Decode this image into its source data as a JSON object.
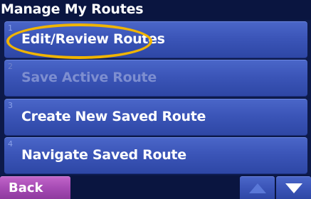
{
  "title": "Manage My Routes",
  "menu": [
    {
      "number": "1",
      "label": "Edit/Review Routes",
      "enabled": true
    },
    {
      "number": "2",
      "label": "Save Active Route",
      "enabled": false
    },
    {
      "number": "3",
      "label": "Create New Saved Route",
      "enabled": true
    },
    {
      "number": "4",
      "label": "Navigate Saved Route",
      "enabled": true
    }
  ],
  "bottom": {
    "back_label": "Back",
    "scroll_up_icon": "triangle-up-icon",
    "scroll_down_icon": "triangle-down-icon"
  },
  "colors": {
    "highlight": "#f0b400",
    "button_blue": "#3b55b8",
    "back_purple": "#a64bb4"
  }
}
